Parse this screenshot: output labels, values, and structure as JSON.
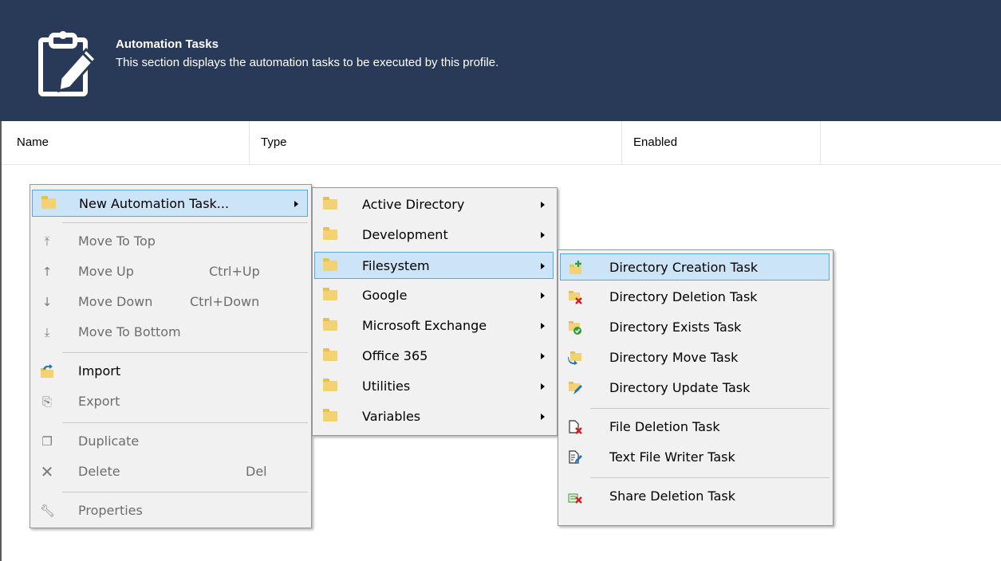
{
  "header": {
    "title": "Automation Tasks",
    "subtitle": "This section displays the automation tasks to be executed by this profile."
  },
  "columns": [
    "Name",
    "Type",
    "Enabled"
  ],
  "context_menu": {
    "items": [
      {
        "label": "New Automation Task...",
        "icon": "folder-icon",
        "submenu": true,
        "enabled": true,
        "highlighted": true
      },
      {
        "label": "Move To Top",
        "icon": "move-to-top-icon",
        "enabled": false
      },
      {
        "label": "Move Up",
        "shortcut": "Ctrl+Up",
        "icon": "arrow-up-icon",
        "enabled": false
      },
      {
        "label": "Move Down",
        "shortcut": "Ctrl+Down",
        "icon": "arrow-down-icon",
        "enabled": false
      },
      {
        "label": "Move To Bottom",
        "icon": "move-to-bottom-icon",
        "enabled": false
      },
      {
        "label": "Import",
        "icon": "import-icon",
        "enabled": true
      },
      {
        "label": "Export",
        "icon": "export-icon",
        "enabled": false
      },
      {
        "label": "Duplicate",
        "icon": "duplicate-icon",
        "enabled": false
      },
      {
        "label": "Delete",
        "shortcut": "Del",
        "icon": "delete-icon",
        "enabled": false
      },
      {
        "label": "Properties",
        "icon": "wrench-icon",
        "enabled": false
      }
    ]
  },
  "category_menu": {
    "items": [
      {
        "label": "Active Directory",
        "icon": "folder-icon"
      },
      {
        "label": "Development",
        "icon": "folder-icon"
      },
      {
        "label": "Filesystem",
        "icon": "folder-icon",
        "highlighted": true
      },
      {
        "label": "Google",
        "icon": "folder-icon"
      },
      {
        "label": "Microsoft Exchange",
        "icon": "folder-icon"
      },
      {
        "label": "Office 365",
        "icon": "folder-icon"
      },
      {
        "label": "Utilities",
        "icon": "folder-icon"
      },
      {
        "label": "Variables",
        "icon": "folder-icon"
      }
    ]
  },
  "filesystem_menu": {
    "items": [
      {
        "label": "Directory Creation Task",
        "icon": "folder-add-icon",
        "highlighted": true
      },
      {
        "label": "Directory Deletion Task",
        "icon": "folder-delete-icon"
      },
      {
        "label": "Directory Exists Task",
        "icon": "folder-check-icon"
      },
      {
        "label": "Directory Move Task",
        "icon": "folder-move-icon"
      },
      {
        "label": "Directory Update Task",
        "icon": "folder-edit-icon"
      },
      {
        "label": "File Deletion Task",
        "icon": "file-delete-icon"
      },
      {
        "label": "Text File Writer Task",
        "icon": "file-edit-icon"
      },
      {
        "label": "Share Deletion Task",
        "icon": "share-delete-icon"
      }
    ]
  },
  "colors": {
    "header_bg": "#283a57",
    "highlight_bg": "#cce4f7",
    "highlight_border": "#5aa7dd"
  }
}
